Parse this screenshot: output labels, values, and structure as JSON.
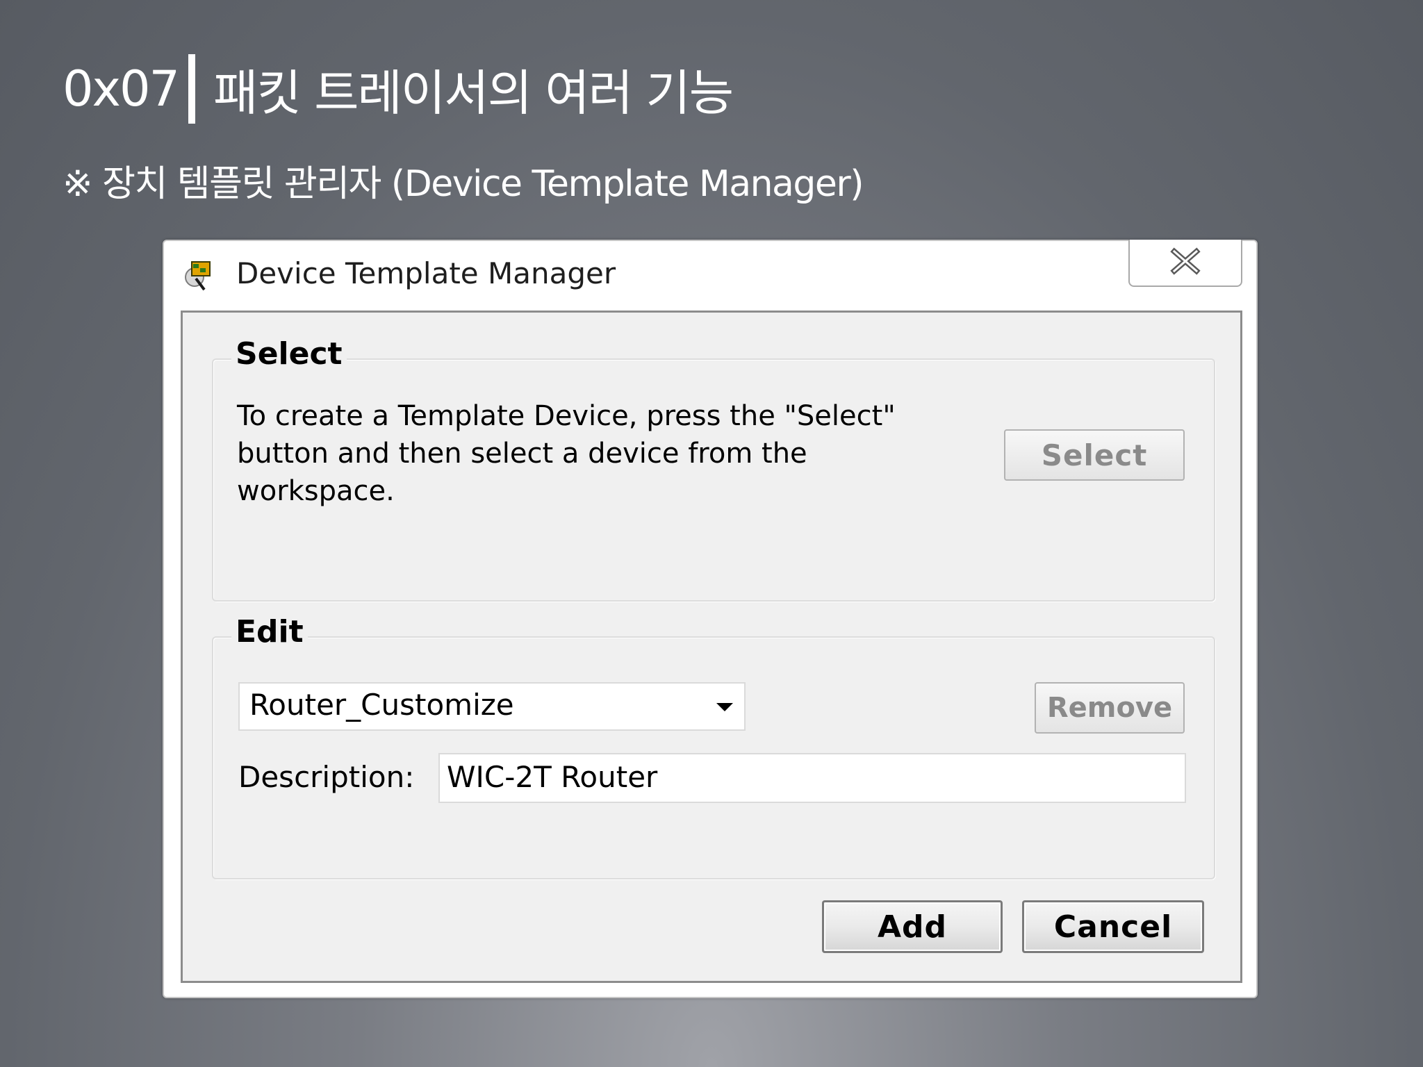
{
  "slide": {
    "number": "0x07",
    "title": "패킷 트레이서의 여러 기능",
    "subtitle": "※ 장치 템플릿 관리자 (Device Template Manager)"
  },
  "dialog": {
    "title": "Device Template Manager",
    "title_icon": "router-template-icon",
    "close_icon": "close-icon",
    "select_group": {
      "legend": "Select",
      "instructions": "To create a Template Device, press the \"Select\" button and then select a device from the workspace.",
      "button_label": "Select"
    },
    "edit_group": {
      "legend": "Edit",
      "template_selected": "Router_Customize",
      "remove_label": "Remove",
      "description_label": "Description:",
      "description_value": "WIC-2T Router"
    },
    "footer": {
      "add_label": "Add",
      "cancel_label": "Cancel"
    }
  }
}
